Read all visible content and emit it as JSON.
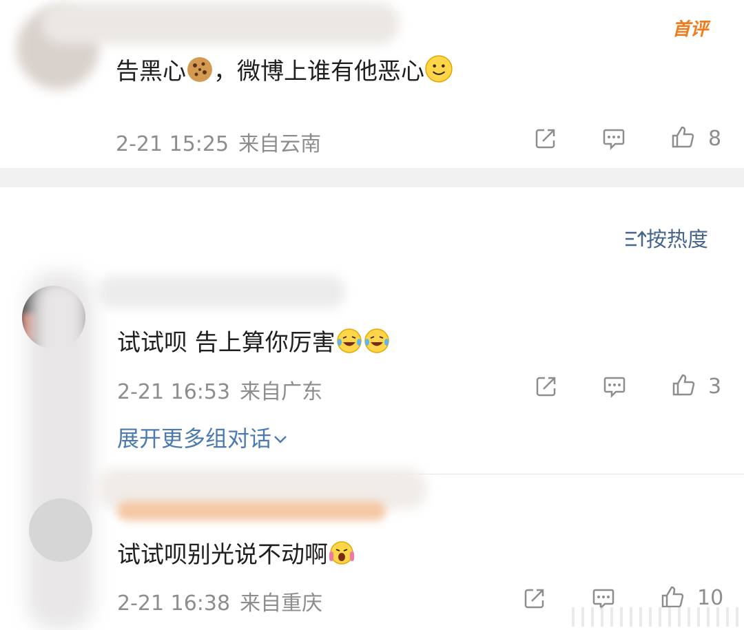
{
  "top_comment": {
    "badge": "首评",
    "text_a": "告黑心",
    "text_b": "，微博上谁有他恶心",
    "time": "2-21 15:25",
    "location": "来自云南",
    "likes": "8"
  },
  "sort": {
    "label": "按热度"
  },
  "comment_1": {
    "text": "试试呗 告上算你厉害",
    "time": "2-21 16:53",
    "location": "来自广东",
    "likes": "3",
    "expand_label": "展开更多组对话"
  },
  "comment_2": {
    "text": "试试呗别光说不动啊",
    "time": "2-21 16:38",
    "location": "来自重庆",
    "likes": "10"
  },
  "icons": [
    "share-icon",
    "comment-icon",
    "like-icon",
    "sort-icon",
    "chevron-down-icon",
    "cookie-emoji",
    "smile-emoji",
    "laugh-cry-emoji",
    "scream-emoji"
  ]
}
